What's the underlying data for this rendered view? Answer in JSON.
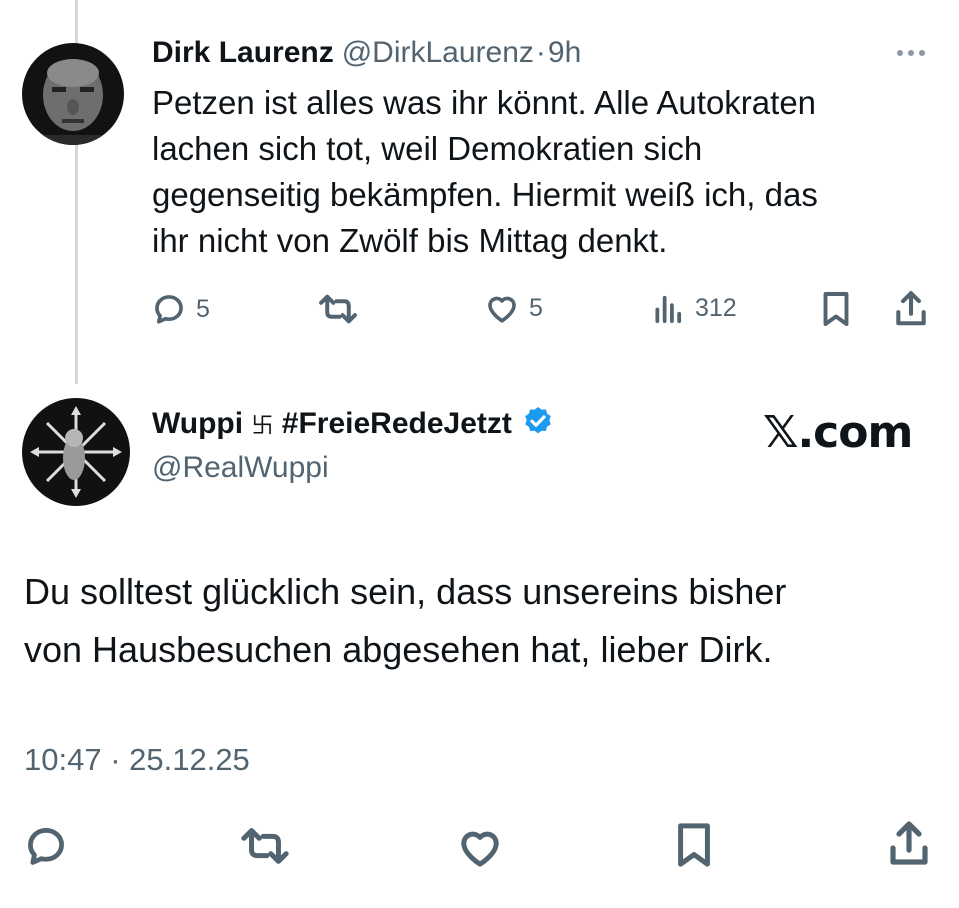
{
  "tweet1": {
    "display_name": "Dirk Laurenz",
    "handle": "@DirkLaurenz",
    "separator": "·",
    "time": "9h",
    "text_lines": [
      "Petzen ist alles was ihr könnt. Alle Autokraten",
      "lachen sich tot, weil Demokratien sich",
      "gegenseitig bekämpfen. Hiermit weiß ich, das",
      "ihr nicht von Zwölf bis Mittag denkt."
    ],
    "replies": "5",
    "likes": "5",
    "views": "312",
    "icons": [
      "reply-icon",
      "repost-icon",
      "like-icon",
      "views-icon",
      "bookmark-icon",
      "share-icon",
      "more-icon"
    ]
  },
  "tweet2": {
    "display_name_start": "Wuppi ",
    "name_symbol": "卐",
    "hashtag": " #FreieRedeJetzt",
    "verified": true,
    "handle": "@RealWuppi",
    "text_lines": [
      "Du solltest glücklich sein, dass unsereins bisher",
      "von Hausbesuchen abgesehen hat, lieber Dirk."
    ],
    "timestamp": "10:47 · 25.12.25",
    "icons": [
      "reply-icon",
      "repost-icon",
      "like-icon",
      "bookmark-icon",
      "share-icon"
    ]
  },
  "watermark": "𝕏.com",
  "colors": {
    "text": "#0f1419",
    "muted": "#536471",
    "verified": "#1d9bf0",
    "thread_line": "#cfd9de"
  }
}
